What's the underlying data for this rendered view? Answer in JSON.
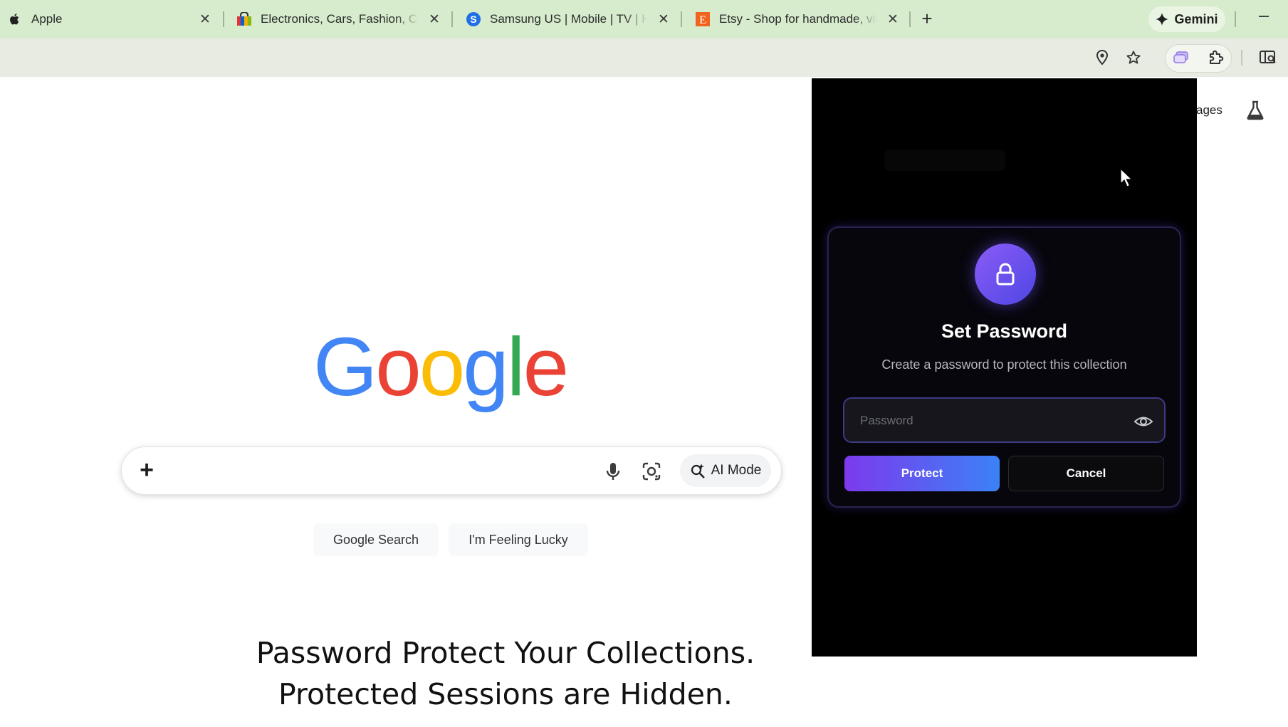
{
  "tabs": [
    {
      "title": "Apple",
      "favicon": "apple-logo-icon"
    },
    {
      "title": "Electronics, Cars, Fashion, Collectibles & More | eBay",
      "favicon": "ebay-bag-icon"
    },
    {
      "title": "Samsung US | Mobile | TV | Home Electronics",
      "favicon": "samsung-s-icon"
    },
    {
      "title": "Etsy - Shop for handmade, vintage, custom, and unique gifts",
      "favicon": "etsy-e-icon"
    }
  ],
  "gemini": {
    "label": "Gemini"
  },
  "page": {
    "top_link": "ages",
    "search": {
      "placeholder": "",
      "ai_mode_label": "AI Mode"
    },
    "buttons": {
      "search": "Google Search",
      "lucky": "I'm Feeling Lucky"
    },
    "caption": {
      "line1": "Password Protect Your Collections.",
      "line2": "Protected Sessions are Hidden."
    }
  },
  "popup": {
    "title": "Set Password",
    "subtitle": "Create a password to protect this collection",
    "password_placeholder": "Password",
    "protect_label": "Protect",
    "cancel_label": "Cancel"
  },
  "colors": {
    "tabstrip_bg": "#d7ebcd",
    "accent_purple": "#7c3aed",
    "accent_blue": "#3b82f6",
    "google_blue": "#4285F4",
    "google_red": "#EA4335",
    "google_yellow": "#FBBC05",
    "google_green": "#34A853"
  }
}
